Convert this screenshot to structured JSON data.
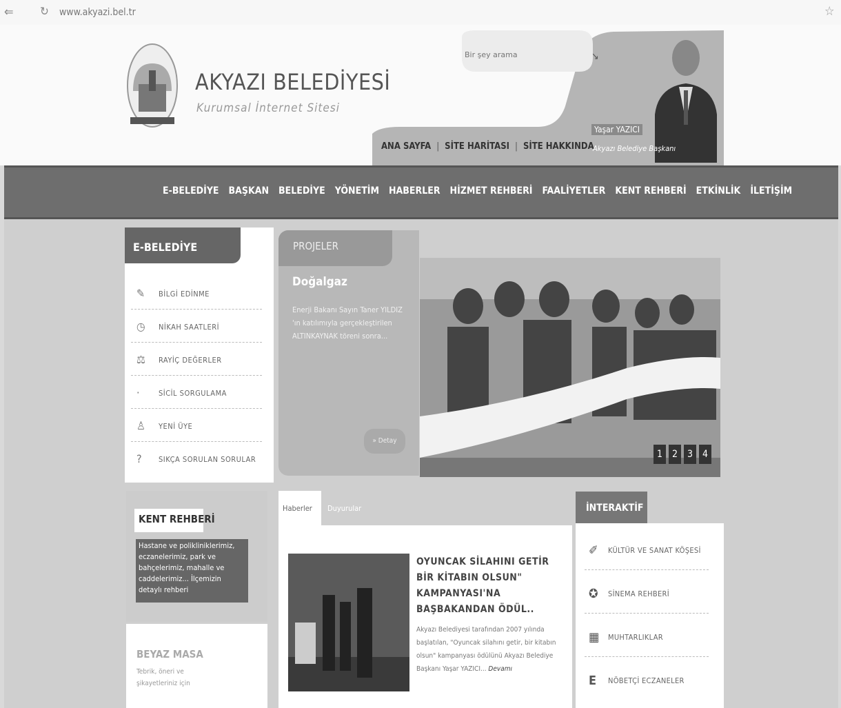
{
  "browser": {
    "url": "www.akyazi.bel.tr"
  },
  "header": {
    "title": "AKYAZI BELEDİYESİ",
    "subtitle": "Kurumsal İnternet Sitesi",
    "search_placeholder": "Bir şey arama",
    "top_links": [
      "ANA SAYFA",
      "SİTE HARİTASI",
      "SİTE HAKKINDA"
    ],
    "mayor_name": "Yaşar YAZICI",
    "mayor_title": "Akyazı Belediye Başkanı"
  },
  "nav": {
    "items": [
      "E-BELEDİYE",
      "BAŞKAN",
      "BELEDİYE",
      "YÖNETİM",
      "HABERLER",
      "HİZMET REHBERİ",
      "FAALİYETLER",
      "KENT REHBERİ",
      "ETKİNLİK",
      "İLETİŞİM"
    ]
  },
  "ebelediye": {
    "title": "E-BELEDİYE",
    "items": [
      "BİLGİ EDİNME",
      "NİKAH SAATLERİ",
      "RAYİÇ DEĞERLER",
      "SİCİL SORGULAMA",
      "YENİ ÜYE",
      "SIKÇA SORULAN SORULAR"
    ]
  },
  "projeler": {
    "label": "PROJELER",
    "headline": "Doğalgaz",
    "description": "Enerji Bakanı Sayın Taner YILDIZ 'ın katılımıyla gerçekleştirilen ALTINKAYNAK töreni sonra...",
    "button": "» Detay",
    "pages": [
      "1",
      "2",
      "3",
      "4"
    ]
  },
  "kent_rehberi": {
    "title": "KENT REHBERİ",
    "description": "Hastane ve polikliniklerimiz, eczanelerimiz, park ve bahçelerimiz, mahalle ve caddelerimiz... İlçemizin detaylı rehberi"
  },
  "beyaz_masa": {
    "title": "BEYAZ MASA",
    "description": "Tebrik, öneri ve şikayetleriniz için"
  },
  "news": {
    "tabs": [
      "Haberler",
      "Duyurular"
    ],
    "headline": "OYUNCAK SİLAHINI GETİR BİR KİTABIN OLSUN\" KAMPANYASI'NA BAŞBAKANDAN ÖDÜL..",
    "body": "Akyazı Belediyesi tarafından 2007 yılında başlatılan, \"Oyuncak silahını getir, bir kitabın olsun\" kampanyası ödülünü Akyazı Belediye Başkanı Yaşar YAZICI...",
    "more": "Devamı"
  },
  "interaktif": {
    "title": "İNTERAKTİF",
    "items": [
      "KÜLTÜR VE SANAT KÖŞESİ",
      "SİNEMA REHBERİ",
      "MUHTARLIKLAR",
      "NÖBETÇİ ECZANELER"
    ]
  }
}
